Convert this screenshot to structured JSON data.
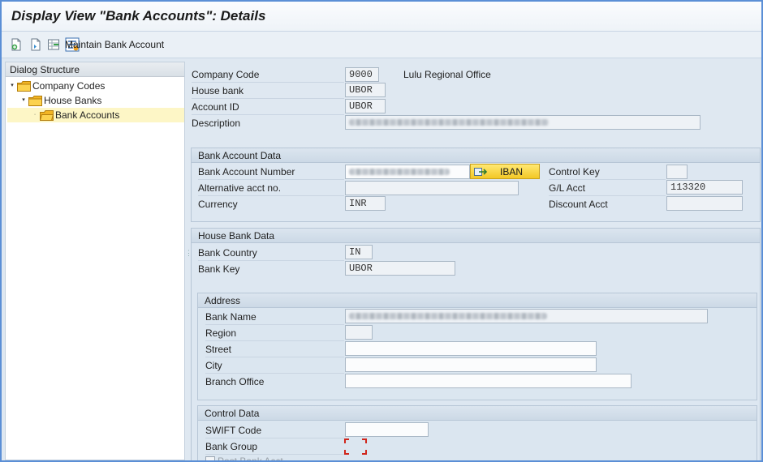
{
  "title": "Display View \"Bank Accounts\": Details",
  "toolbar": {
    "maintain_label": "Maintain Bank Account"
  },
  "tree": {
    "header": "Dialog Structure",
    "items": [
      {
        "label": "Company Codes"
      },
      {
        "label": "House Banks"
      },
      {
        "label": "Bank Accounts"
      }
    ]
  },
  "header_fields": {
    "company_code": {
      "label": "Company Code",
      "value": "9000",
      "text": "Lulu Regional Office"
    },
    "house_bank": {
      "label": "House bank",
      "value": "UBOR"
    },
    "account_id": {
      "label": "Account ID",
      "value": "UBOR"
    },
    "description": {
      "label": "Description"
    }
  },
  "bank_account_data": {
    "title": "Bank Account Data",
    "bank_account_number": {
      "label": "Bank Account Number"
    },
    "iban_label": "IBAN",
    "control_key": {
      "label": "Control Key",
      "value": ""
    },
    "alt_acct": {
      "label": "Alternative acct no.",
      "value": ""
    },
    "gl_acct": {
      "label": "G/L Acct",
      "value": "113320"
    },
    "currency": {
      "label": "Currency",
      "value": "INR"
    },
    "discount_acct": {
      "label": "Discount Acct",
      "value": ""
    }
  },
  "house_bank_data": {
    "title": "House Bank Data",
    "bank_country": {
      "label": "Bank Country",
      "value": "IN"
    },
    "bank_key": {
      "label": "Bank Key",
      "value": "UBOR"
    }
  },
  "address": {
    "title": "Address",
    "bank_name": {
      "label": "Bank Name"
    },
    "region": {
      "label": "Region",
      "value": ""
    },
    "street": {
      "label": "Street",
      "value": ""
    },
    "city": {
      "label": "City",
      "value": ""
    },
    "branch": {
      "label": "Branch Office",
      "value": ""
    }
  },
  "control_data": {
    "title": "Control Data",
    "swift": {
      "label": "SWIFT Code",
      "value": ""
    },
    "bank_group": {
      "label": "Bank Group",
      "value": ""
    },
    "post_bank_acct": {
      "label": "Post Bank Acct"
    }
  },
  "colors": {
    "accent_border": "#5b8fd6",
    "selection": "#fdf6c6",
    "iban_button": "#f3c825",
    "required_marker": "#d0261c"
  }
}
